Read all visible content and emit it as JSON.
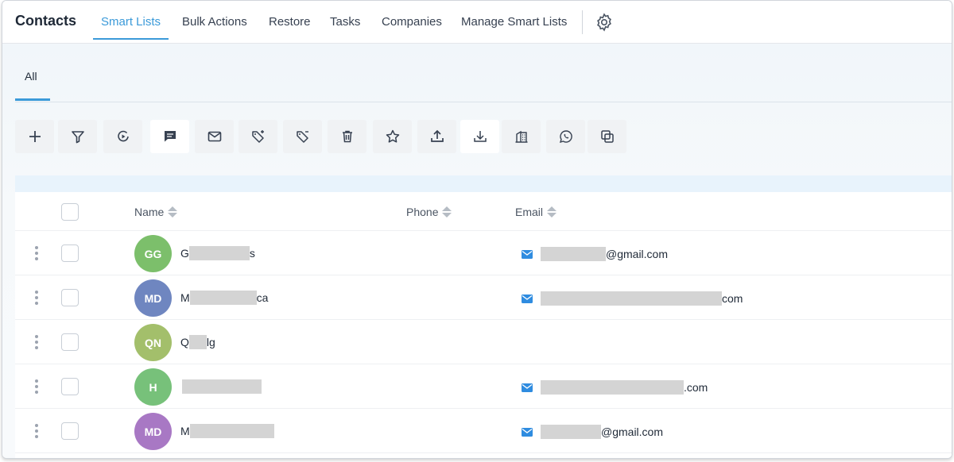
{
  "header": {
    "title": "Contacts",
    "tabs": [
      {
        "label": "Smart Lists",
        "active": true
      },
      {
        "label": "Bulk Actions"
      },
      {
        "label": "Restore"
      },
      {
        "label": "Tasks"
      },
      {
        "label": "Companies"
      },
      {
        "label": "Manage Smart Lists"
      }
    ],
    "settings_icon": "gear-icon"
  },
  "subtabs": [
    {
      "label": "All",
      "active": true
    }
  ],
  "toolbar": {
    "buttons": [
      {
        "icon": "plus-icon"
      },
      {
        "icon": "filter-icon"
      },
      {
        "icon": "workflow-icon"
      },
      {
        "icon": "sms-icon"
      },
      {
        "icon": "email-icon"
      },
      {
        "icon": "add-tag-icon"
      },
      {
        "icon": "remove-tag-icon"
      },
      {
        "icon": "trash-icon"
      },
      {
        "icon": "star-icon"
      },
      {
        "icon": "export-icon"
      },
      {
        "icon": "import-icon"
      },
      {
        "icon": "company-icon"
      },
      {
        "icon": "whatsapp-icon"
      },
      {
        "icon": "merge-icon"
      }
    ]
  },
  "table": {
    "columns": [
      "Name",
      "Phone",
      "Email"
    ],
    "rows": [
      {
        "initials": "GG",
        "avatar_color": "#7cbf6b",
        "name_start": "G",
        "name_end": "s",
        "email_suffix": "@gmail.com"
      },
      {
        "initials": "MD",
        "avatar_color": "#6f86c0",
        "name_start": "M",
        "name_end": "ca",
        "email_suffix": "com"
      },
      {
        "initials": "QN",
        "avatar_color": "#a3bf6b",
        "name_start": "Q",
        "name_end": "lg",
        "email_suffix": ""
      },
      {
        "initials": "H",
        "avatar_color": "#77c17a",
        "name_start": "",
        "name_end": "",
        "email_suffix": ".com"
      },
      {
        "initials": "MD",
        "avatar_color": "#a878c4",
        "name_start": "M",
        "name_end": "",
        "email_suffix": "@gmail.com"
      }
    ]
  },
  "colors": {
    "accent": "#3b9ad9",
    "email_icon": "#2f8ce0"
  }
}
